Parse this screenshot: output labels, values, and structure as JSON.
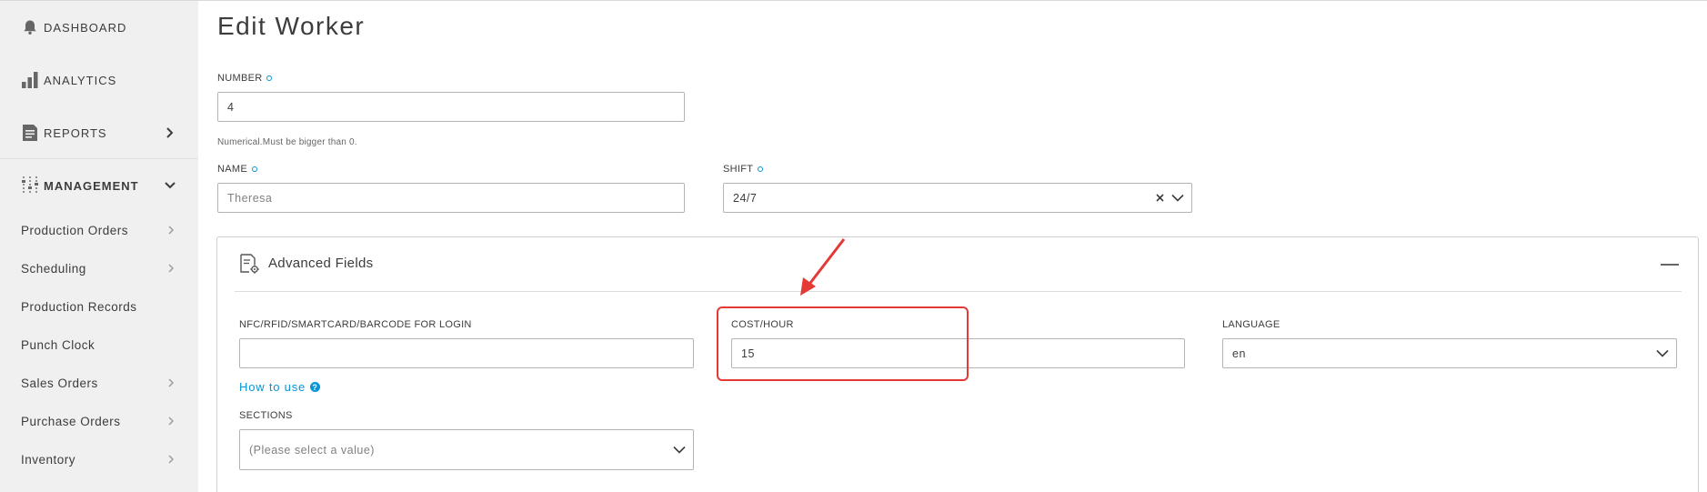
{
  "sidebar": {
    "top_items": [
      {
        "label": "DASHBOARD",
        "icon": "bell-icon"
      },
      {
        "label": "ANALYTICS",
        "icon": "bar-chart-icon"
      },
      {
        "label": "REPORTS",
        "icon": "report-icon"
      },
      {
        "label": "MANAGEMENT",
        "icon": "sliders-icon"
      }
    ],
    "sub_items": [
      {
        "label": "Production Orders",
        "has_chevron": true
      },
      {
        "label": "Scheduling",
        "has_chevron": true
      },
      {
        "label": "Production Records",
        "has_chevron": false
      },
      {
        "label": "Punch Clock",
        "has_chevron": false
      },
      {
        "label": "Sales Orders",
        "has_chevron": true
      },
      {
        "label": "Purchase Orders",
        "has_chevron": true
      },
      {
        "label": "Inventory",
        "has_chevron": true
      }
    ]
  },
  "page": {
    "title": "Edit Worker"
  },
  "form": {
    "number": {
      "label": "NUMBER",
      "value": "4",
      "hint": "Numerical.Must be bigger than 0."
    },
    "name": {
      "label": "NAME",
      "value": "Theresa"
    },
    "shift": {
      "label": "SHIFT",
      "value": "24/7"
    }
  },
  "advanced": {
    "title": "Advanced Fields",
    "nfc": {
      "label": "NFC/RFID/SMARTCARD/BARCODE FOR LOGIN",
      "value": ""
    },
    "how_to_use": "How to use",
    "cost_hour": {
      "label": "COST/HOUR",
      "value": "15"
    },
    "language": {
      "label": "LANGUAGE",
      "value": "en"
    },
    "sections": {
      "label": "SECTIONS",
      "placeholder": "(Please select a value)"
    }
  },
  "colors": {
    "accent": "#0696d7",
    "annotation": "#e53935",
    "sidebar_bg": "#f0f0f0"
  }
}
